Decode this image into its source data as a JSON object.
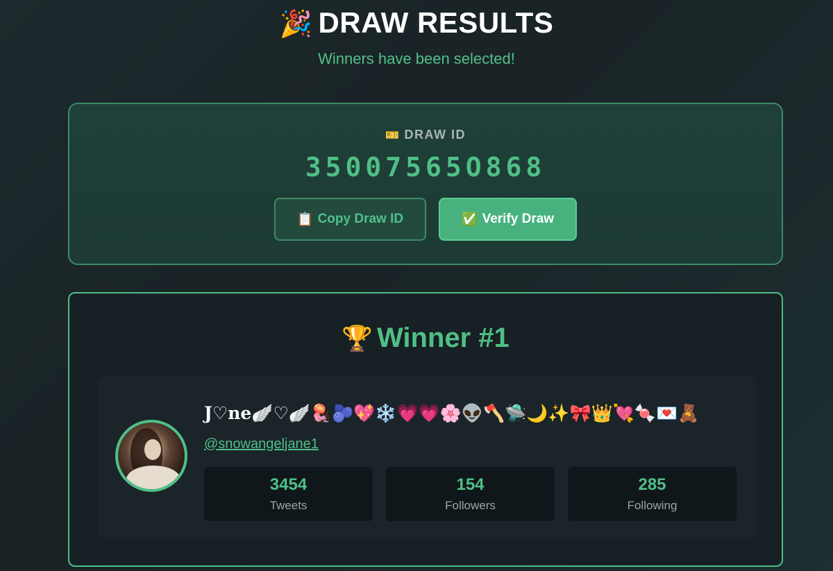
{
  "header": {
    "title_icon": "🎉",
    "title": "DRAW RESULTS",
    "subtitle": "Winners have been selected!"
  },
  "draw": {
    "label_icon": "🎫",
    "label": "DRAW ID",
    "id": "35007565O868",
    "copy_button": {
      "icon": "📋",
      "label": "Copy Draw ID"
    },
    "verify_button": {
      "icon": "✅",
      "label": "Verify Draw"
    }
  },
  "winner": {
    "title_icon": "🏆",
    "title": "Winner #1",
    "display_name": "J♡ne🪽♡🪽🪼🫐💖❄️💗💗🌸👽🪓🛸🌙✨🎀👑💘🍬💌🧸",
    "handle": "@snowangeljane1",
    "stats": [
      {
        "value": "3454",
        "label": "Tweets"
      },
      {
        "value": "154",
        "label": "Followers"
      },
      {
        "value": "285",
        "label": "Following"
      }
    ]
  },
  "colors": {
    "accent": "#4fbf86",
    "background": "#1a2326",
    "card": "#1d3a34",
    "winner_card": "#172024"
  }
}
